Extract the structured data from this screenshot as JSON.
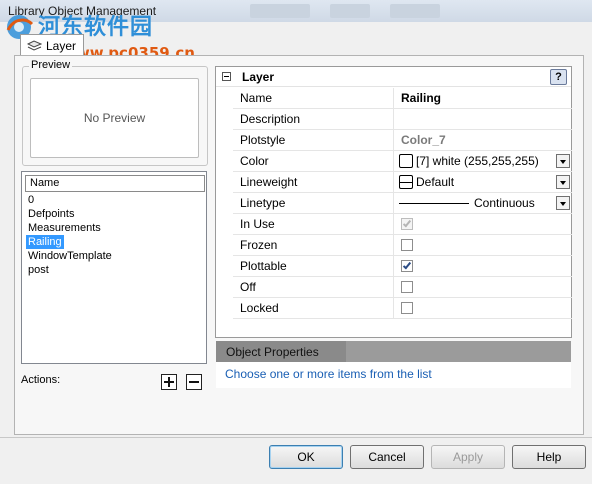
{
  "window": {
    "title": "Library Object Management"
  },
  "watermark": {
    "cn_text": "河东软件园",
    "url": "www.pc0359.cn"
  },
  "tabs": [
    {
      "label": "Layer"
    }
  ],
  "preview": {
    "legend": "Preview",
    "empty_text": "No Preview"
  },
  "list": {
    "header": "Name",
    "items": [
      "0",
      "Defpoints",
      "Measurements",
      "Railing",
      "WindowTemplate",
      "post"
    ],
    "selected_index": 3
  },
  "actions": {
    "label": "Actions:",
    "add_icon": "plus-icon",
    "remove_icon": "minus-icon"
  },
  "properties": {
    "category": "Layer",
    "help_label": "?",
    "rows": [
      {
        "name": "Name",
        "value": "Railing"
      },
      {
        "name": "Description",
        "value": ""
      },
      {
        "name": "Plotstyle",
        "value": "Color_7"
      },
      {
        "name": "Color",
        "value": "[7] white (255,255,255)",
        "swatch_color": "#ffffff"
      },
      {
        "name": "Lineweight",
        "value": "Default"
      },
      {
        "name": "Linetype",
        "value": "Continuous"
      },
      {
        "name": "In Use",
        "checked": true,
        "disabled": true
      },
      {
        "name": "Frozen",
        "checked": false
      },
      {
        "name": "Plottable",
        "checked": true
      },
      {
        "name": "Off",
        "checked": false
      },
      {
        "name": "Locked",
        "checked": false
      }
    ]
  },
  "object_properties": {
    "tab_label": "Object Properties",
    "hint": "Choose one or more items from the list"
  },
  "buttons": {
    "ok": "OK",
    "cancel": "Cancel",
    "apply": "Apply",
    "help": "Help"
  },
  "colors": {
    "selection": "#3399ff",
    "hint_link": "#1a5fb4",
    "watermark_blue": "#2f8fd8",
    "watermark_orange": "#e05a12"
  }
}
